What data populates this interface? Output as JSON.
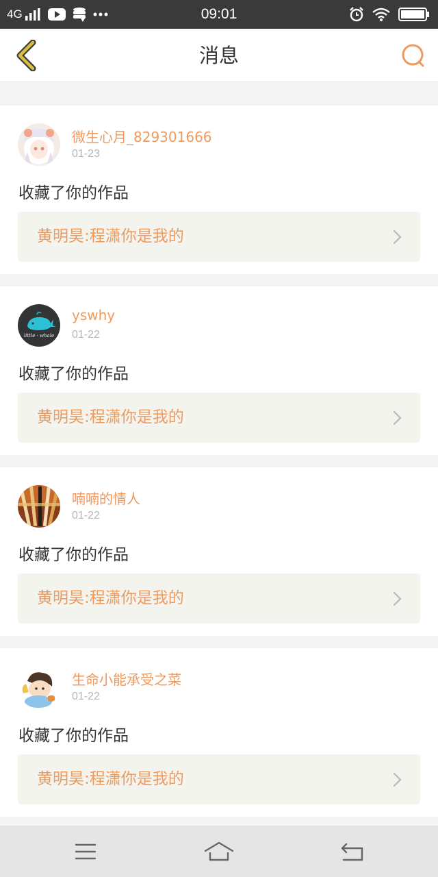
{
  "status_bar": {
    "network": "4G",
    "time": "09:01",
    "icons": [
      "signal-icon",
      "video-app-icon",
      "storage-icon",
      "more-dots-icon",
      "alarm-icon",
      "wifi-icon",
      "battery-icon"
    ]
  },
  "header": {
    "title": "消息",
    "back_icon": "chevron-left-icon",
    "search_icon": "search-icon"
  },
  "messages": [
    {
      "username": "微生心月_829301666",
      "date": "01-23",
      "action": "收藏了你的作品",
      "work_title": "黄明昊:程潇你是我的",
      "avatar": "anime-girl-avatar"
    },
    {
      "username": "yswhy",
      "date": "01-22",
      "action": "收藏了你的作品",
      "work_title": "黄明昊:程潇你是我的",
      "avatar": "whale-avatar"
    },
    {
      "username": "喃喃的情人",
      "date": "01-22",
      "action": "收藏了你的作品",
      "work_title": "黄明昊:程潇你是我的",
      "avatar": "brushes-avatar"
    },
    {
      "username": "生命小能承受之菜",
      "date": "01-22",
      "action": "收藏了你的作品",
      "work_title": "黄明昊:程潇你是我的",
      "avatar": "cartoon-avatar"
    }
  ],
  "nav_bar": {
    "menu_icon": "menu-icon",
    "home_icon": "home-icon",
    "back_icon": "back-arrow-icon"
  },
  "colors": {
    "accent": "#ee9a5f",
    "back_arrow": "#d9bf3d",
    "status_bar": "#3a3a3a",
    "card_link_bg": "#f4f4ef"
  }
}
